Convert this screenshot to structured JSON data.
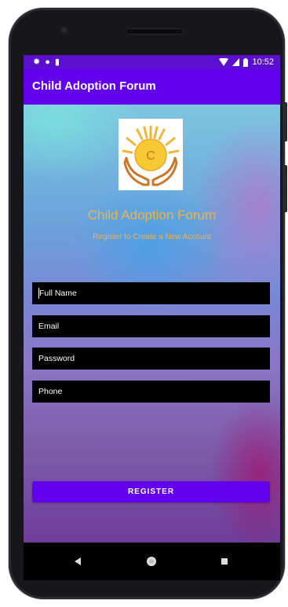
{
  "statusbar": {
    "time": "10:52"
  },
  "appbar": {
    "title": "Child Adoption Forum"
  },
  "main": {
    "app_name": "Child Adoption Forum",
    "subtitle": "Register to Create a New Account",
    "fields": {
      "full_name": "Full Name",
      "email": "Email",
      "password": "Password",
      "phone": "Phone"
    },
    "register_label": "REGISTER"
  },
  "logo": {
    "letter": "C"
  },
  "colors": {
    "primary": "#6200ee",
    "status_bar": "#5a0fcf",
    "accent_text": "#f2b24a"
  },
  "icons": [
    "gear-icon",
    "circle-icon",
    "sd-card-icon",
    "wifi-icon",
    "signal-icon",
    "battery-icon",
    "back-icon",
    "home-icon",
    "recents-icon"
  ]
}
